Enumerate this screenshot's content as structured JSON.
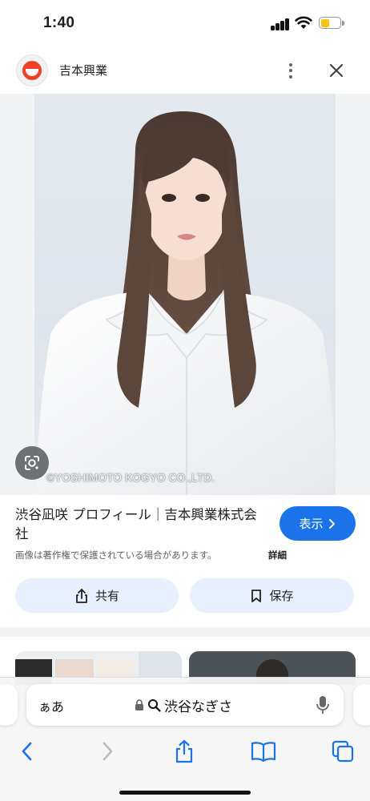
{
  "status_bar": {
    "time": "1:40",
    "battery_level": 0.45,
    "icons": [
      "signal-icon",
      "wifi-icon",
      "battery-icon"
    ]
  },
  "source": {
    "name": "吉本興業",
    "logo_icon": "yoshimoto-smile-logo"
  },
  "image": {
    "watermark": "©YOSHIMOTO KOGYO CO.,LTD.",
    "lens_icon": "google-lens-icon"
  },
  "result": {
    "title": "渋谷凪咲 プロフィール｜吉本興業株式会社",
    "view_label": "表示",
    "copyright_note": "画像は著作権で保護されている場合があります。",
    "details_label": "詳細",
    "share_label": "共有",
    "save_label": "保存"
  },
  "browser": {
    "aa_label": "ぁあ",
    "url_query": "渋谷なぎさ",
    "toolbar_icons": [
      "back-icon",
      "forward-icon",
      "share-icon",
      "bookmarks-icon",
      "tabs-icon"
    ]
  },
  "colors": {
    "accent": "#1a73e8",
    "pill_bg": "#e8f0fe",
    "battery": "#f5c518",
    "logo": "#ef3f2b"
  }
}
